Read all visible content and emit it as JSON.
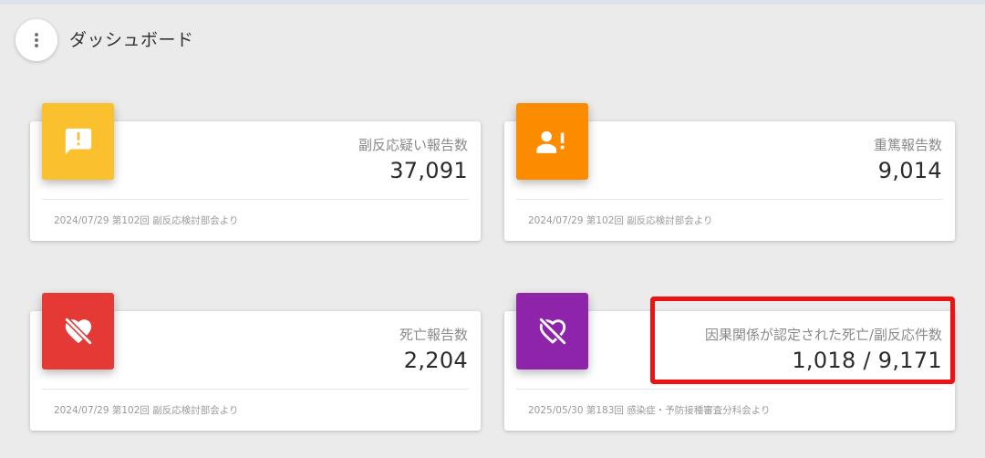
{
  "header": {
    "title": "ダッシュボード",
    "menu_icon": "more-vertical-icon"
  },
  "cards": [
    {
      "label": "副反応疑い報告数",
      "value": "37,091",
      "footer": "2024/07/29 第102回 副反応検討部会より",
      "icon": "report-alert-icon",
      "icon_color": "#fbc02d"
    },
    {
      "label": "重篤報告数",
      "value": "9,014",
      "footer": "2024/07/29 第102回 副反応検討部会より",
      "icon": "person-alert-icon",
      "icon_color": "#fb8c00"
    },
    {
      "label": "死亡報告数",
      "value": "2,204",
      "footer": "2024/07/29 第102回 副反応検討部会より",
      "icon": "heart-off-icon",
      "icon_color": "#e53935"
    },
    {
      "label": "因果関係が認定された死亡/副反応件数",
      "value": "1,018 / 9,171",
      "footer": "2025/05/30 第183回 感染症・予防接種審査分科会より",
      "icon": "heart-broken-outline-icon",
      "icon_color": "#8e24aa"
    }
  ],
  "annotation": {
    "color": "#ee1111"
  }
}
